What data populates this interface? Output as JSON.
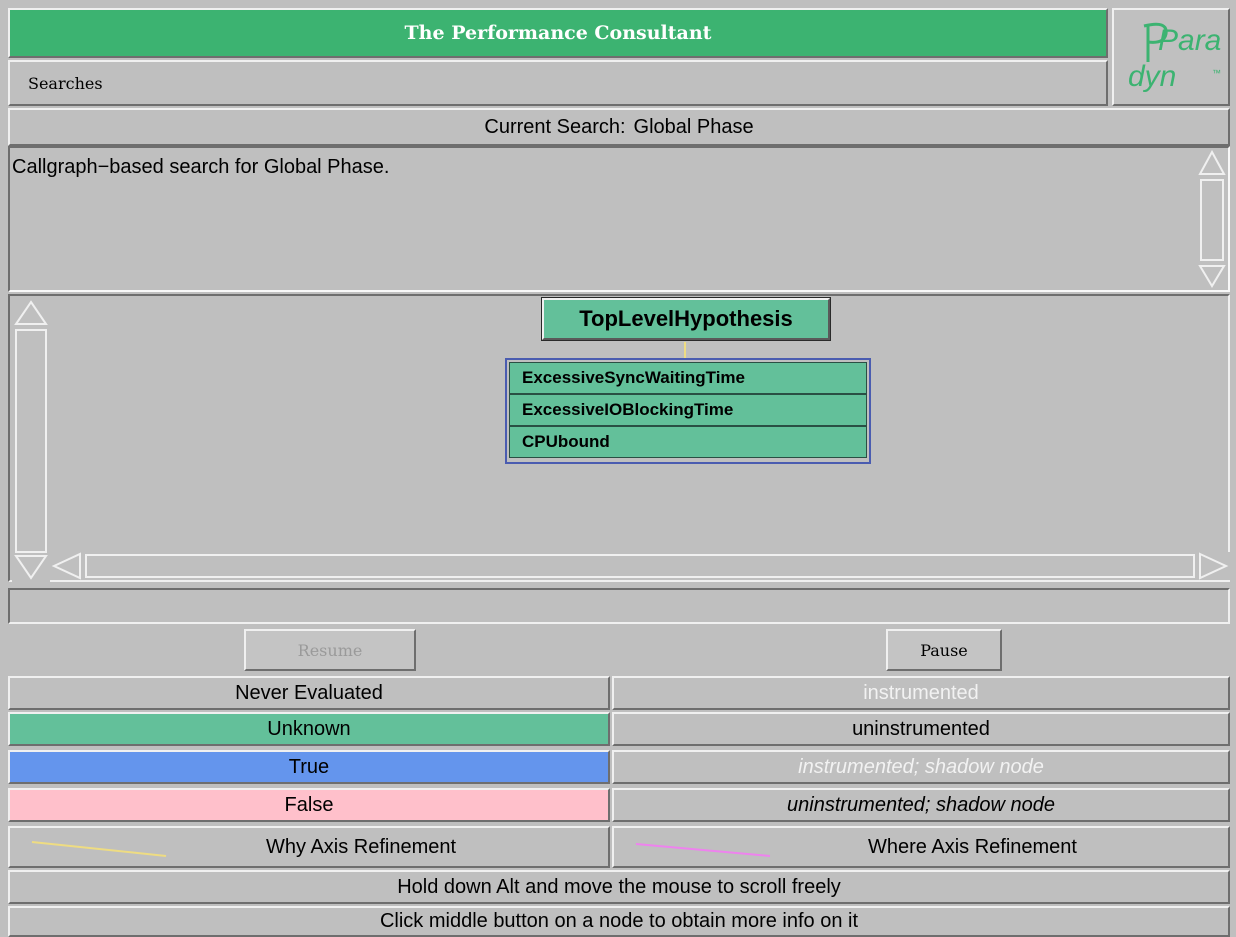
{
  "window": {
    "title": "The Performance Consultant",
    "menu": [
      "Searches"
    ],
    "logo": {
      "top": "Para",
      "bottom": "dyn",
      "trademark": "™"
    }
  },
  "search": {
    "label": "Current Search:",
    "value": "Global Phase",
    "description": "Callgraph−based search for Global Phase."
  },
  "graph": {
    "root": "TopLevelHypothesis",
    "children": [
      "ExcessiveSyncWaitingTime",
      "ExcessiveIOBlockingTime",
      "CPUbound"
    ]
  },
  "controls": {
    "resume_label": "Resume",
    "pause_label": "Pause"
  },
  "legend": {
    "states": [
      {
        "label": "Never Evaluated",
        "color": "#bfbfbf"
      },
      {
        "label": "Unknown",
        "color": "#63c09a"
      },
      {
        "label": "True",
        "color": "#6495ed"
      },
      {
        "label": "False",
        "color": "#ffc0cb"
      }
    ],
    "instrumentation": [
      {
        "label": "instrumented"
      },
      {
        "label": "uninstrumented"
      },
      {
        "label": "instrumented; shadow node"
      },
      {
        "label": "uninstrumented; shadow node"
      }
    ],
    "why_axis": {
      "label": "Why Axis Refinement",
      "color": "#eedc82"
    },
    "where_axis": {
      "label": "Where Axis Refinement",
      "color": "#ee82ee"
    }
  },
  "hints": [
    "Hold down Alt and move the mouse to scroll freely",
    "Click middle button on a node to obtain more info on it"
  ]
}
